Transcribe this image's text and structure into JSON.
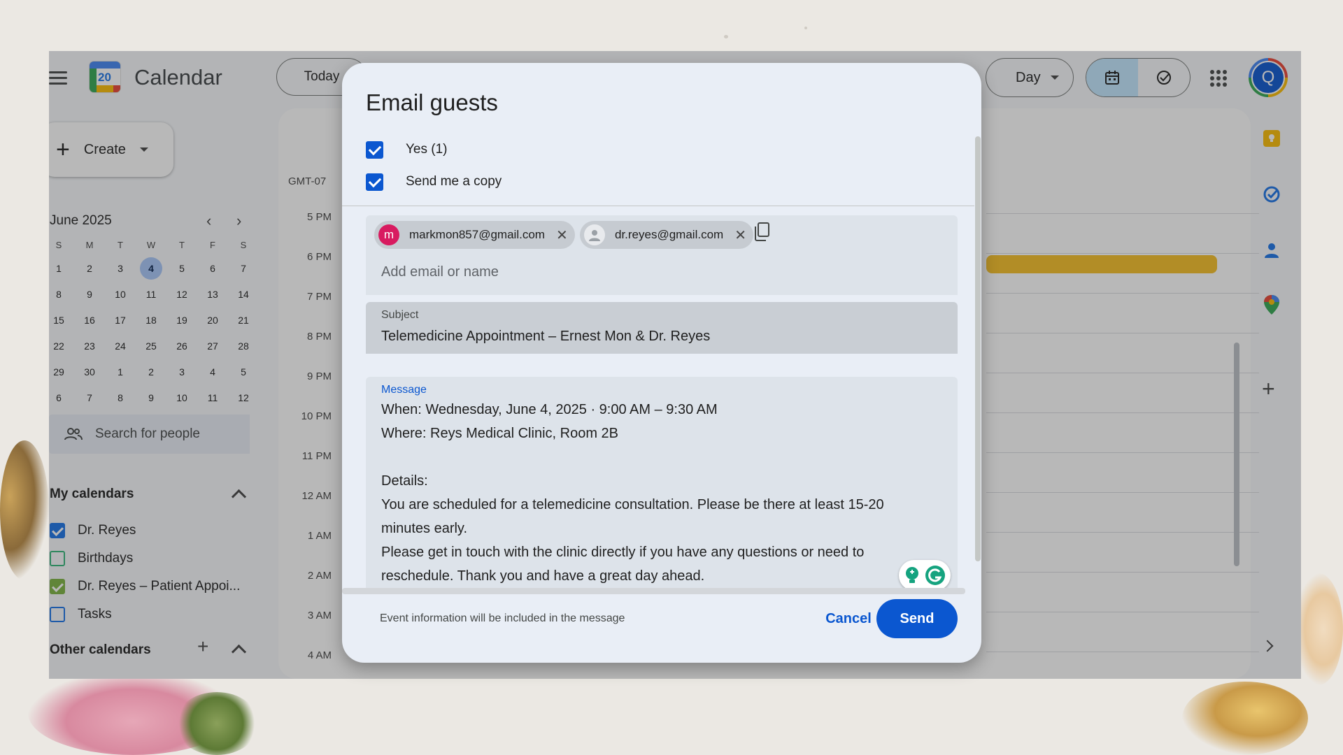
{
  "app": {
    "title": "Calendar",
    "logo_day": "20",
    "today_label": "Today",
    "view_label": "Day",
    "avatar_initial": "Q"
  },
  "sidebar": {
    "create_label": "Create",
    "mini_calendar": {
      "month_label": "June 2025",
      "weekday_headers": [
        "S",
        "M",
        "T",
        "W",
        "T",
        "F",
        "S"
      ],
      "weeks": [
        [
          "1",
          "2",
          "3",
          "4",
          "5",
          "6",
          "7"
        ],
        [
          "8",
          "9",
          "10",
          "11",
          "12",
          "13",
          "14"
        ],
        [
          "15",
          "16",
          "17",
          "18",
          "19",
          "20",
          "21"
        ],
        [
          "22",
          "23",
          "24",
          "25",
          "26",
          "27",
          "28"
        ],
        [
          "29",
          "30",
          "1",
          "2",
          "3",
          "4",
          "5"
        ],
        [
          "6",
          "7",
          "8",
          "9",
          "10",
          "11",
          "12"
        ]
      ],
      "selected_day": "4"
    },
    "search_people_placeholder": "Search for people",
    "my_calendars_title": "My calendars",
    "my_calendars": [
      {
        "label": "Dr. Reyes",
        "checked": true,
        "color": "#1a73e8"
      },
      {
        "label": "Birthdays",
        "checked": false,
        "color": "#33b679"
      },
      {
        "label": "Dr. Reyes – Patient Appoi...",
        "checked": true,
        "color": "#7cb342"
      },
      {
        "label": "Tasks",
        "checked": false,
        "color": "#1a73e8"
      }
    ],
    "other_calendars_title": "Other calendars"
  },
  "day_view": {
    "timezone": "GMT-07",
    "hours": [
      "5 PM",
      "6 PM",
      "7 PM",
      "8 PM",
      "9 PM",
      "10 PM",
      "11 PM",
      "12 AM",
      "1 AM",
      "2 AM",
      "3 AM",
      "4 AM"
    ],
    "event_color": "#f6bf26"
  },
  "dialog": {
    "title": "Email guests",
    "checkboxes": [
      {
        "label": "Yes (1)",
        "checked": true
      },
      {
        "label": "Send me a copy",
        "checked": true
      }
    ],
    "recipients": [
      {
        "email": "markmon857@gmail.com",
        "initial": "m",
        "avatar_color": "#d81b60"
      },
      {
        "email": "dr.reyes@gmail.com",
        "initial": "",
        "avatar_color": "#9aa0a6"
      }
    ],
    "add_recipient_placeholder": "Add email or name",
    "subject_label": "Subject",
    "subject_value": "Telemedicine Appointment – Ernest Mon & Dr. Reyes",
    "message_label": "Message",
    "message_lines": [
      "When: Wednesday, June 4, 2025 · 9:00 AM – 9:30 AM",
      "Where: Reys Medical Clinic, Room 2B",
      "",
      "Details:",
      "You are scheduled for a telemedicine consultation. Please be there at least 15-20",
      "minutes early.",
      "Please get in touch with the clinic directly if you have any questions or need to",
      "reschedule. Thank you and have a great day ahead."
    ],
    "footer_note": "Event information will be included in the message",
    "cancel_label": "Cancel",
    "send_label": "Send"
  }
}
